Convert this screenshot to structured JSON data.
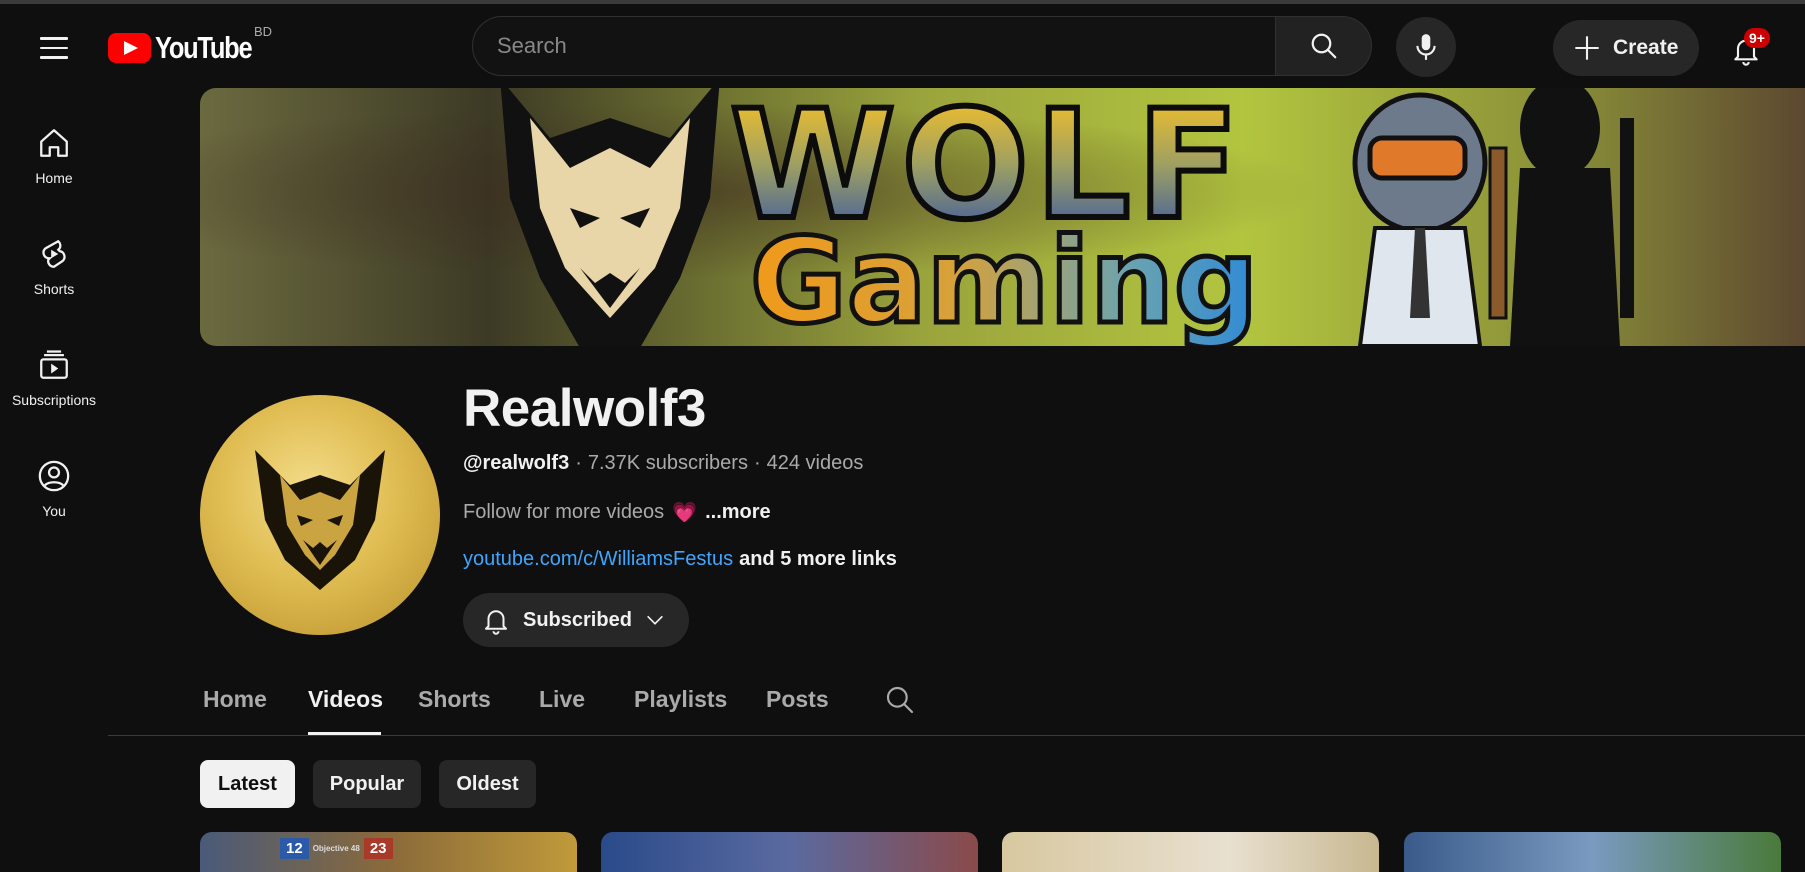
{
  "masthead": {
    "logo_text": "YouTube",
    "country_code": "BD",
    "search_placeholder": "Search",
    "create_label": "Create",
    "notification_badge": "9+"
  },
  "sidebar": {
    "items": [
      {
        "label": "Home",
        "icon": "home-icon"
      },
      {
        "label": "Shorts",
        "icon": "shorts-icon"
      },
      {
        "label": "Subscriptions",
        "icon": "subscriptions-icon"
      },
      {
        "label": "You",
        "icon": "you-icon"
      }
    ]
  },
  "banner": {
    "title": "WOLF",
    "subtitle": "Gaming"
  },
  "channel": {
    "name": "Realwolf3",
    "handle": "@realwolf3",
    "separator": "·",
    "subscribers": "7.37K subscribers",
    "videos": "424 videos",
    "description": "Follow for more videos",
    "description_emoji": "💗",
    "more_label": "...more",
    "link": "youtube.com/c/WilliamsFestus",
    "more_links": "and 5 more links",
    "subscribe_label": "Subscribed"
  },
  "tabs": {
    "items": [
      "Home",
      "Videos",
      "Shorts",
      "Live",
      "Playlists",
      "Posts"
    ],
    "active": "Videos"
  },
  "chips": {
    "items": [
      "Latest",
      "Popular",
      "Oldest"
    ],
    "active": "Latest"
  },
  "thumbnails": {
    "first_overlay_left": "12",
    "first_overlay_label": "Objective 48",
    "first_overlay_right": "23"
  },
  "colors": {
    "background": "#0f0f0f",
    "brand_red": "#ff0000",
    "link_blue": "#3ea6ff",
    "badge_red": "#cc0000",
    "surface": "#272727"
  }
}
